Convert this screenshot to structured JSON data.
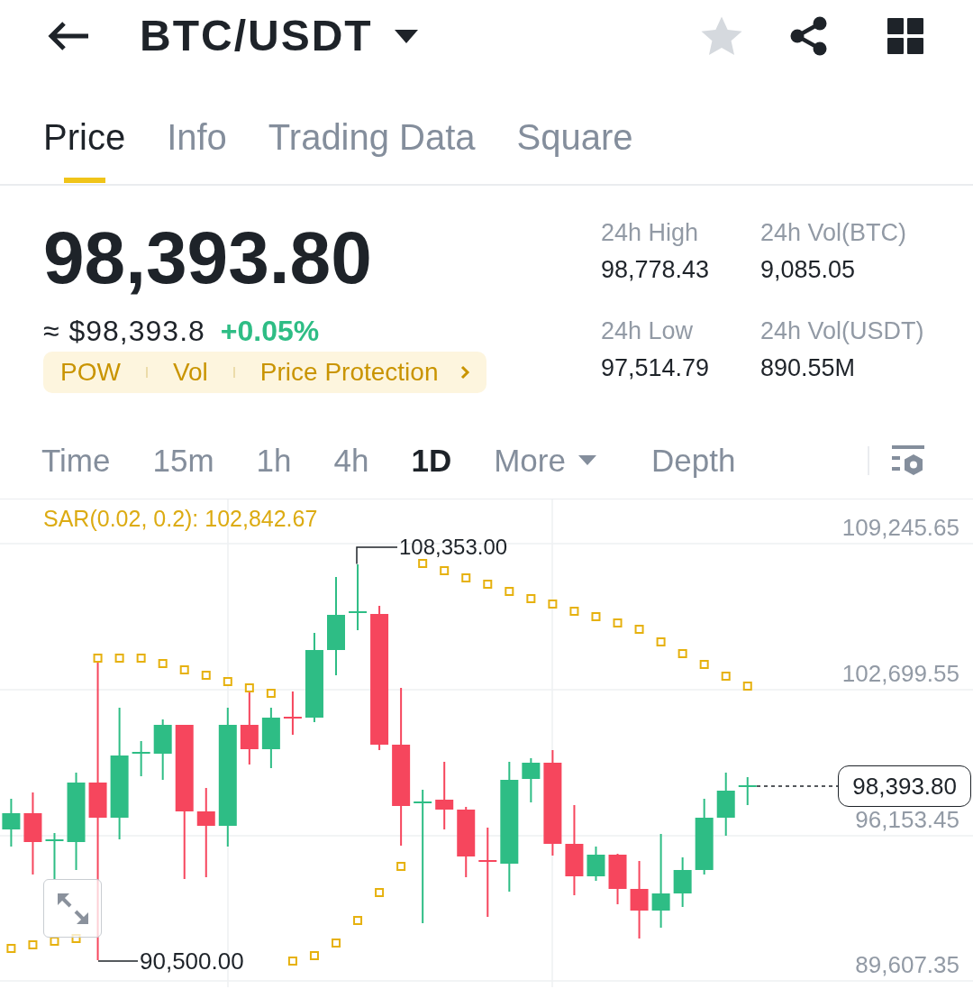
{
  "header": {
    "title": "BTC/USDT",
    "starred": false
  },
  "tabs": [
    {
      "label": "Price",
      "selected": true
    },
    {
      "label": "Info",
      "selected": false
    },
    {
      "label": "Trading Data",
      "selected": false
    },
    {
      "label": "Square",
      "selected": false
    }
  ],
  "ticker": {
    "last_price": "98,393.80",
    "fiat_price": "≈ $98,393.8",
    "change": "+0.05%",
    "tags": [
      "POW",
      "Vol",
      "Price Protection"
    ]
  },
  "stats": [
    {
      "label": "24h High",
      "value": "98,778.43"
    },
    {
      "label": "24h Vol(BTC)",
      "value": "9,085.05"
    },
    {
      "label": "24h Low",
      "value": "97,514.79"
    },
    {
      "label": "24h Vol(USDT)",
      "value": "890.55M"
    }
  ],
  "intervals": [
    {
      "label": "Time",
      "kind": "interval",
      "selected": false
    },
    {
      "label": "15m",
      "kind": "interval",
      "selected": false
    },
    {
      "label": "1h",
      "kind": "interval",
      "selected": false
    },
    {
      "label": "4h",
      "kind": "interval",
      "selected": false
    },
    {
      "label": "1D",
      "kind": "interval",
      "selected": true
    },
    {
      "label": "More",
      "kind": "menu",
      "selected": false
    },
    {
      "label": "Depth",
      "kind": "view",
      "selected": false
    }
  ],
  "chart": {
    "indicator": "SAR(0.02, 0.2): 102,842.67",
    "price_axis": [
      "109,245.65",
      "102,699.55",
      "96,153.45",
      "89,607.35"
    ],
    "high_label": "108,353.00",
    "low_label": "90,500.00",
    "last_price": "98,393.80"
  }
}
